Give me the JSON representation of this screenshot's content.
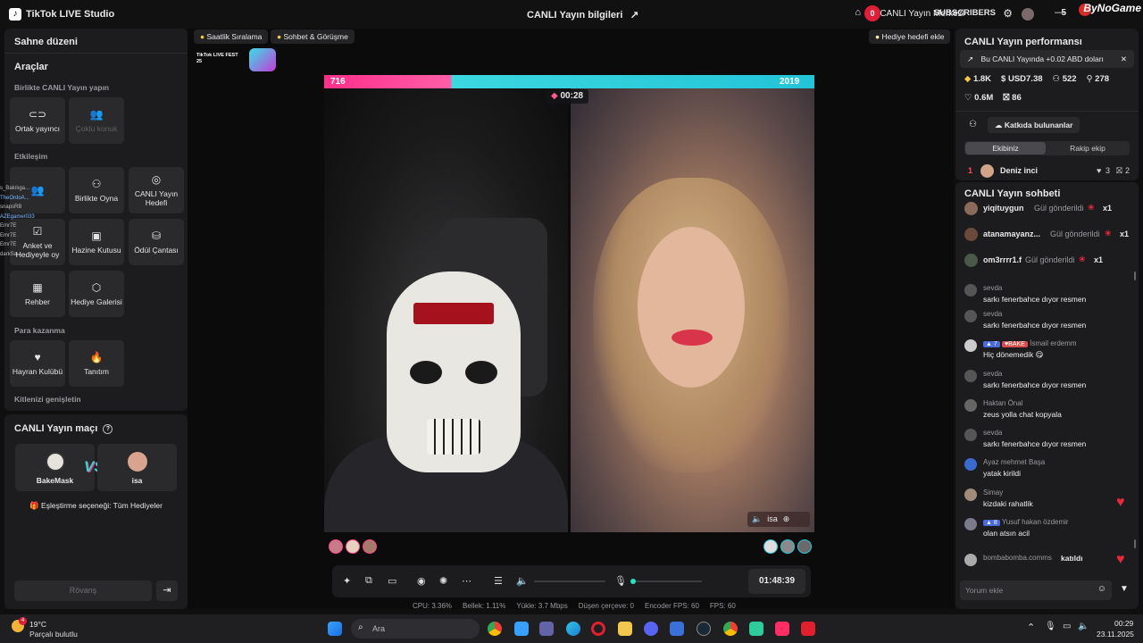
{
  "titlebar": {
    "app_name": "TikTok LIVE Studio",
    "center_title": "CANLI Yayın bilgileri",
    "notif_count": "0",
    "merkez_label": "CANLI Yayın Merkezi",
    "subscribers_label": "SUBSCRIBERS",
    "sub_count": "5",
    "watermark": "ByNoGame"
  },
  "left": {
    "scene_title": "Sahne düzeni",
    "tools_title": "Araçlar",
    "group_together": "Birlikte CANLI Yayın yapın",
    "tile_cohost": "Ortak yayıncı",
    "tile_multiguest": "Çoklu konuk",
    "group_interaction": "Etkileşim",
    "tile_play_together": "Birlikte Oyna",
    "tile_live_goal": "CANLI Yayın Hedefi",
    "tile_poll": "Anket ve Hediyeyle oy",
    "tile_treasure": "Hazine Kutusu",
    "tile_reward_bag": "Ödül Çantası",
    "tile_guide": "Rehber",
    "tile_gift_gallery": "Hediye Galerisi",
    "group_monetize": "Para kazanma",
    "tile_fan_club": "Hayran Kulübü",
    "tile_promote": "Tanıtım",
    "group_grow": "Kitlenizi genişletin",
    "overlay_names": [
      "s_Bakılıga...",
      "TheOrdoA...",
      "snapsRB",
      "AZEgamer033",
      "Emr7E",
      "Emr7E",
      "Emr7E",
      "darkSa..."
    ]
  },
  "match": {
    "title": "CANLI Yayın maçı",
    "player1": "BakeMask",
    "vs": "VS",
    "player2": "isa",
    "pairing": "Eşleştirme seçeneği: Tüm Hediyeler",
    "rematch": "Rövanş"
  },
  "stage": {
    "chip_hourly": "Saatlik Sıralama",
    "chip_chat": "Sohbet & Görüşme",
    "chip_gift_goal": "Hediye hedefi ekle",
    "fest_label": "TikTok LIVE FEST 25",
    "score_left": "716",
    "score_right": "2019",
    "match_timer": "00:28",
    "right_host_tag": "isa",
    "elapsed": "01:48:39"
  },
  "stats": {
    "cpu": "CPU: 3.36%",
    "memory": "Bellek: 1.11%",
    "upload": "Yükle: 3.7 Mbps",
    "dropped": "Düşen çerçeve: 0",
    "encoder": "Encoder FPS: 60",
    "fps": "FPS: 60"
  },
  "performance": {
    "title": "CANLI Yayın performansı",
    "banner": "Bu CANLI Yayında +0.02 ABD doları",
    "diamonds": "1.8K",
    "usd": "USD7.38",
    "viewers": "522",
    "followers": "278",
    "likes": "0.6M",
    "gifts": "86",
    "contributors": "Katkıda bulunanlar",
    "tab_mine": "Ekibiniz",
    "tab_rival": "Rakip ekip",
    "rank1_num": "1",
    "rank1_name": "Deniz inci",
    "rank1_hearts": "3",
    "rank1_gifts": "2"
  },
  "chat": {
    "title": "CANLI Yayın sohbeti",
    "gifts": [
      {
        "user": "yiqituygun",
        "action": "Gül gönderildi",
        "mult": "x1"
      },
      {
        "user": "atanamayanz...",
        "action": "Gül gönderildi",
        "mult": "x1"
      },
      {
        "user": "om3rrrr1.f",
        "action": "Gül gönderildi",
        "mult": "x1"
      }
    ],
    "messages": [
      {
        "name": "sevda",
        "text": "sarkı fenerbahce dıyor resmen"
      },
      {
        "name": "sevda",
        "text": "sarkı fenerbahce dıyor resmen"
      },
      {
        "name": "İsmail erdemm",
        "badge1": "7",
        "badge2": "BAKE",
        "text": "Hiç dönemedik 😋"
      },
      {
        "name": "sevda",
        "text": "sarkı fenerbahce dıyor resmen"
      },
      {
        "name": "Haktan Önal",
        "text": "zeus yolla chat kopyala"
      },
      {
        "name": "sevda",
        "text": "sarkı fenerbahce dıyor resmen"
      },
      {
        "name": "Ayaz mehmet Başa",
        "text": "yatak kirildi"
      },
      {
        "name": "Simay",
        "text": "kizdaki rahatlik"
      },
      {
        "name": "Yusuf hakan özdemir",
        "badge1": "8",
        "text": "olan atsın acil"
      },
      {
        "name": "bombabomba.comms",
        "text": "katıldı"
      }
    ],
    "input_placeholder": "Yorum ekle"
  },
  "taskbar": {
    "weather_temp": "19°C",
    "weather_desc": "Parçalı bulutlu",
    "weather_alert": "4",
    "search_placeholder": "Ara",
    "time": "00:29",
    "date": "23.11.2025"
  },
  "colors": {
    "accent_pink": "#ff2e8a",
    "accent_cyan": "#23c4d8",
    "panel": "#1c1c1e",
    "heart_red": "#e8283f"
  }
}
